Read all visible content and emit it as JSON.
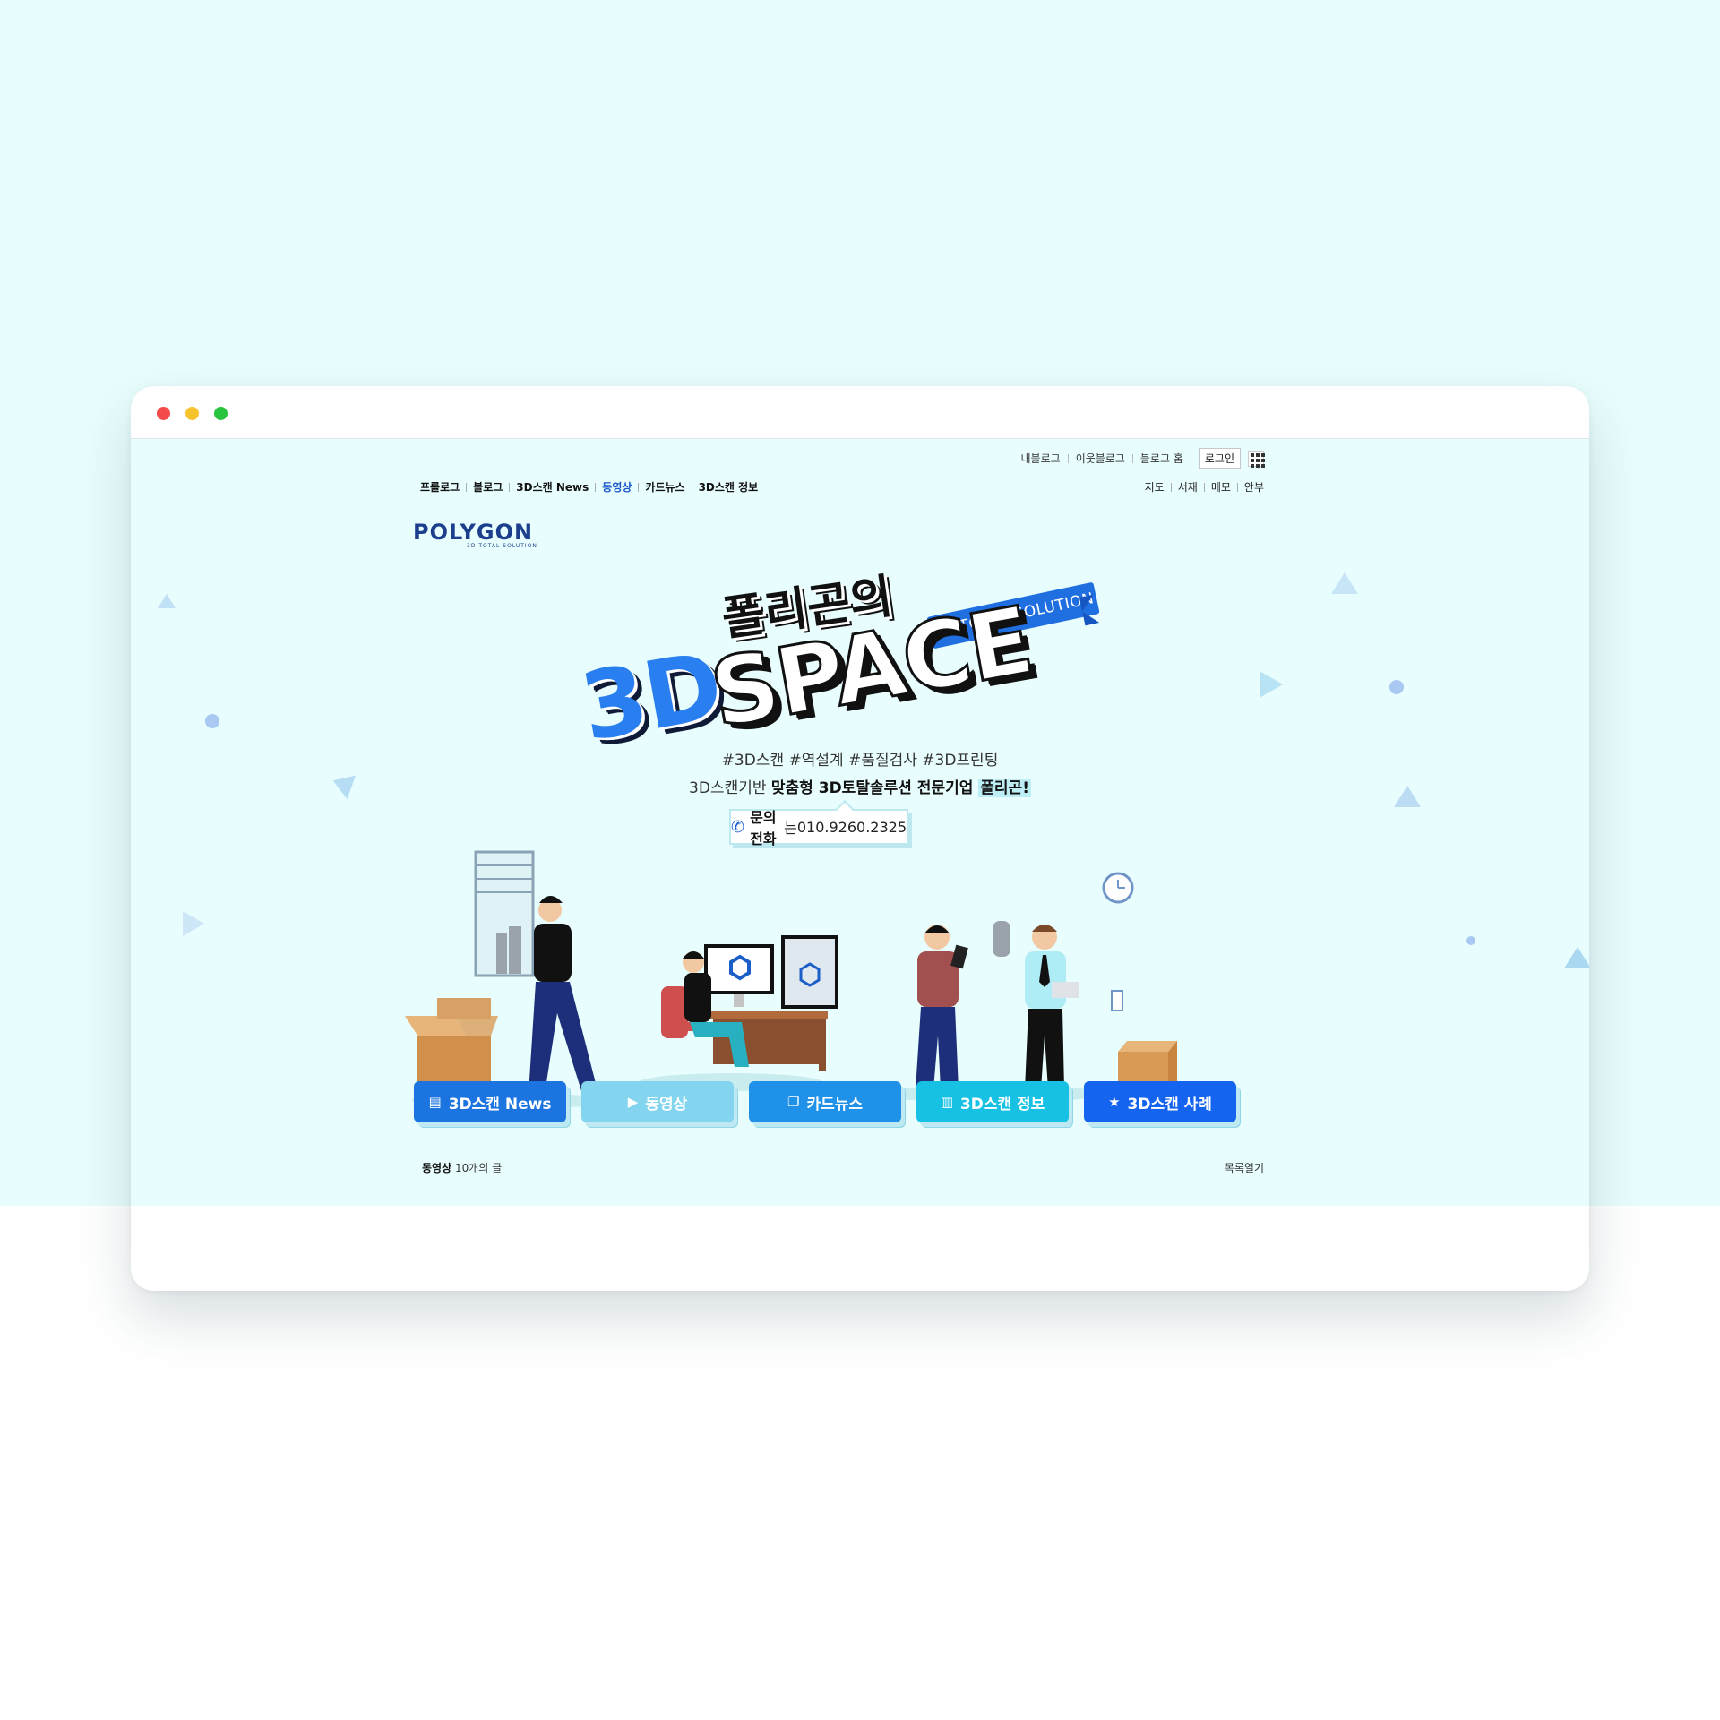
{
  "window": {
    "controls": [
      "close",
      "minimize",
      "maximize"
    ]
  },
  "util_nav": {
    "items": [
      "내블로그",
      "이웃블로그",
      "블로그 홈"
    ],
    "login": "로그인",
    "apps_icon": "grid-icon"
  },
  "main_nav": {
    "items": [
      "프롤로그",
      "블로그",
      "3D스캔 News",
      "동영상",
      "카드뉴스",
      "3D스캔 정보"
    ],
    "active": "동영상"
  },
  "sub_nav": {
    "items": [
      "지도",
      "서재",
      "메모",
      "안부"
    ]
  },
  "logo": {
    "main": "POLYGON",
    "sub": "3D TOTAL SOLUTION"
  },
  "hero": {
    "title_ko": "폴리곤의",
    "ribbon": "3D TOTAL SOLUTION",
    "title_3d": "3D",
    "title_space": "SPACE",
    "hashtags": "#3D스캔 #역설계 #품질검사 #3D프린팅",
    "tagline_pre": "3D스캔기반 ",
    "tagline_bold": "맞춤형 3D토탈솔루션 전문기업 ",
    "tagline_highlight": "폴리곤!",
    "call_label": "문의전화",
    "call_suffix": "는 ",
    "call_number": "010.9260.2325"
  },
  "categories": [
    {
      "label": "3D스캔 News",
      "icon": "document-icon"
    },
    {
      "label": "동영상",
      "icon": "play-icon"
    },
    {
      "label": "카드뉴스",
      "icon": "cards-icon"
    },
    {
      "label": "3D스캔 정보",
      "icon": "book-icon"
    },
    {
      "label": "3D스캔 사례",
      "icon": "star-icon"
    }
  ],
  "list_bar": {
    "category": "동영상",
    "count": "10개의 글",
    "toggle": "목록열기"
  },
  "colors": {
    "background": "#e8fdfd",
    "accent_blue": "#1b74e0",
    "logo_navy": "#1c3f8d"
  }
}
